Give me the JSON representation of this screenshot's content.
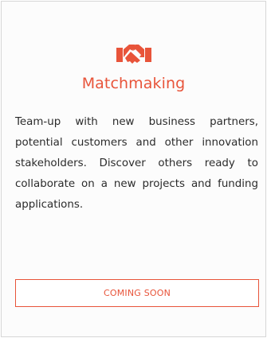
{
  "card": {
    "icon": "handshake-icon",
    "title": "Matchmaking",
    "description": "Team-up with new business partners, potential customers and other innovation stakeholders. Discover others ready to collaborate on a new projects and funding applications.",
    "cta_label": "COMING SOON"
  },
  "colors": {
    "accent": "#e8543a",
    "card_border": "#d6d6d6",
    "text": "#2b2b2b"
  }
}
